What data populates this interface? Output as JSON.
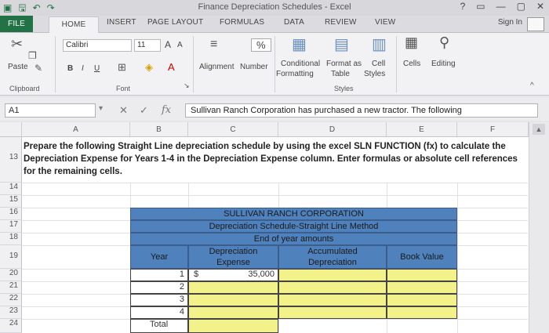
{
  "window": {
    "title": "Finance Depreciation Schedules - Excel",
    "controls": [
      "?",
      "▭",
      "—",
      "▢",
      "✕"
    ]
  },
  "tabs": [
    "FILE",
    "HOME",
    "INSERT",
    "PAGE LAYOUT",
    "FORMULAS",
    "DATA",
    "REVIEW",
    "VIEW"
  ],
  "signin": "Sign In",
  "ribbon": {
    "paste": "Paste",
    "clipboard": "Clipboard",
    "font_name": "Calibri",
    "font_size": "11",
    "font_group": "Font",
    "alignment": "Alignment",
    "number": "Number",
    "number_symbol": "%",
    "conditional": "Conditional",
    "formatting": "Formatting",
    "format_as": "Format as",
    "table": "Table",
    "cell": "Cell",
    "styles_btn": "Styles",
    "styles_group": "Styles",
    "cells": "Cells",
    "editing": "Editing",
    "bold": "B",
    "italic": "I",
    "underline": "U",
    "font_grow": "A",
    "font_shrink": "A"
  },
  "formula_bar": {
    "name_box": "A1",
    "cancel": "✕",
    "enter": "✓",
    "fx": "fx",
    "value": "Sullivan Ranch Corporation has purchased a new tractor.  The following"
  },
  "columns": [
    "A",
    "B",
    "C",
    "D",
    "E",
    "F"
  ],
  "rows": [
    "13",
    "14",
    "15",
    "16",
    "17",
    "18",
    "19",
    "20",
    "21",
    "22",
    "23",
    "24"
  ],
  "instructions": "Prepare the following Straight Line depreciation schedule by using the excel SLN FUNCTION (fx) to calculate the Depreciation Expense for Years 1-4 in the Depreciation Expense column. Enter formulas or absolute cell references for the remaining cells.",
  "schedule": {
    "title1": "SULLIVAN RANCH CORPORATION",
    "title2": "Depreciation Schedule-Straight Line Method",
    "title3": "End of year amounts",
    "headers": {
      "year": "Year",
      "dep1": "Depreciation",
      "dep2": "Expense",
      "acc1": "Accumulated",
      "acc2": "Depreciation",
      "book": "Book Value"
    },
    "currency": "$",
    "first_value": "35,000",
    "years": [
      "1",
      "2",
      "3",
      "4"
    ],
    "total": "Total"
  }
}
